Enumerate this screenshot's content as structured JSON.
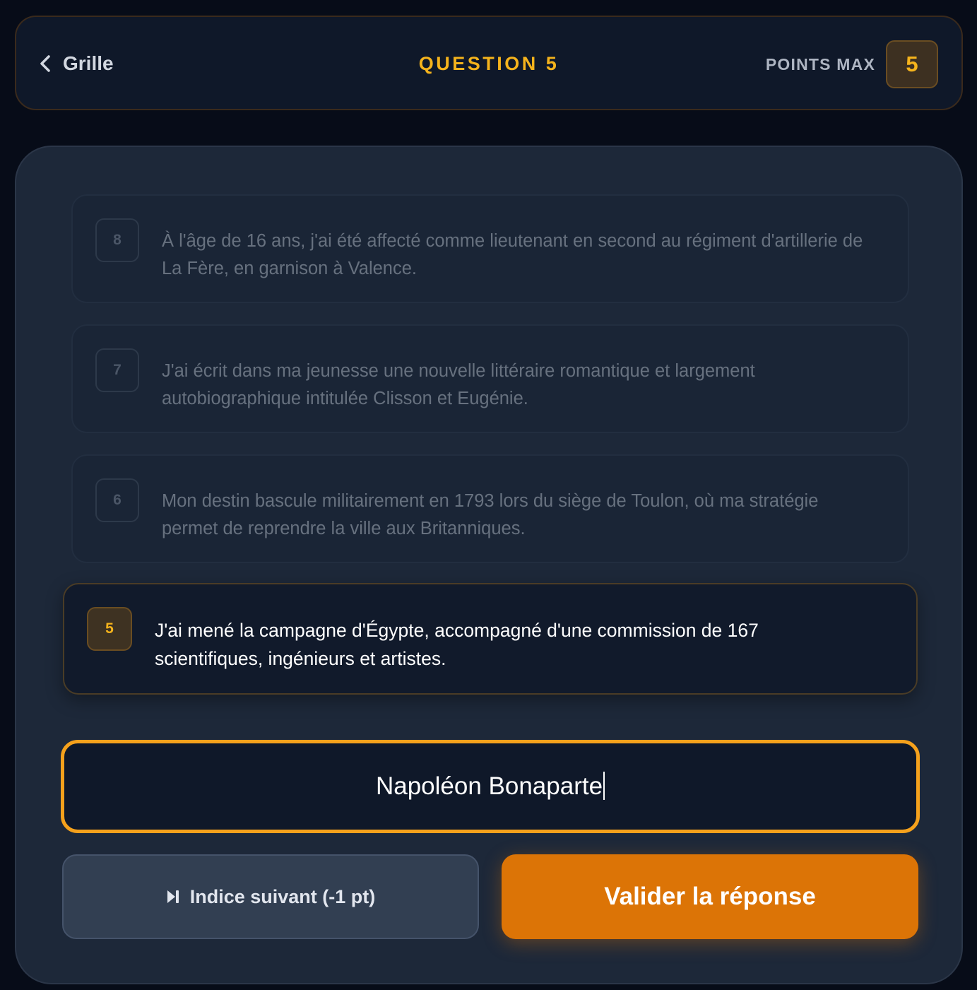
{
  "header": {
    "back_label": "Grille",
    "title": "QUESTION 5",
    "points_label": "POINTS MAX",
    "points_value": "5"
  },
  "hints": [
    {
      "number": "8",
      "text": "À l'âge de 16 ans, j'ai été affecté comme lieutenant en second au régiment d'artillerie de La Fère, en garnison à Valence."
    },
    {
      "number": "7",
      "text": "J'ai écrit dans ma jeunesse une nouvelle littéraire romantique et largement autobiographique intitulée Clisson et Eugénie."
    },
    {
      "number": "6",
      "text": "Mon destin bascule militairement en 1793 lors du siège de Toulon, où ma stratégie permet de reprendre la ville aux Britanniques."
    },
    {
      "number": "5",
      "text": "J'ai mené la campagne d'Égypte, accompagné d'une commission de 167 scientifiques, ingénieurs et artistes."
    }
  ],
  "answer": {
    "value": "Napoléon Bonaparte"
  },
  "buttons": {
    "next_hint": "Indice suivant (-1 pt)",
    "validate": "Valider la réponse"
  },
  "colors": {
    "accent": "#f5b31c",
    "primary_button": "#dc7406",
    "background": "#070c18",
    "card": "#1d2839"
  }
}
